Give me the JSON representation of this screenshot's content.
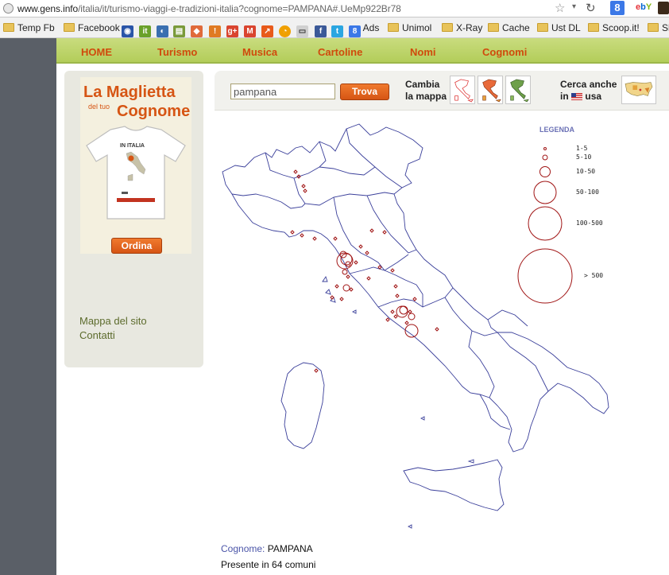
{
  "browser": {
    "url_domain": "www.gens.info",
    "url_path": "/italia/it/turismo-viaggi-e-tradizioni-italia?cognome=PAMPANA#.UeMp922Br78",
    "bookmarks": [
      "Temp Fb",
      "Facebook",
      "Ads",
      "Unimol",
      "X-Ray",
      "Cache",
      "Ust DL",
      "Scoop.it!",
      "Sh"
    ]
  },
  "nav": {
    "items": [
      "HOME",
      "Turismo",
      "Musica",
      "Cartoline",
      "Nomi",
      "Cognomi"
    ]
  },
  "promo": {
    "title_line1": "La Maglietta",
    "title_small": "del tuo",
    "title_line2": "Cognome",
    "shirt_text": "IN ITALIA",
    "order_button": "Ordina",
    "links": [
      "Mappa del sito",
      "Contatti"
    ]
  },
  "search": {
    "value": "pampana",
    "button": "Trova",
    "change_map_line1": "Cambia",
    "change_map_line2": "la mappa",
    "search_also_line1": "Cerca anche",
    "search_also_line2": "in",
    "search_also_country": "usa"
  },
  "legend": {
    "title": "LEGENDA",
    "ranges": [
      "1-5",
      "5-10",
      "10-50",
      "50-100",
      "100-500",
      "> 500"
    ]
  },
  "result": {
    "surname_label": "Cognome:",
    "surname": "PAMPANA",
    "presence": "Presente in 64 comuni"
  },
  "colors": {
    "accent": "#d65514",
    "nav_bg": "#b3cd5a",
    "marker": "#a01414",
    "map_border": "#3a3f9a"
  }
}
